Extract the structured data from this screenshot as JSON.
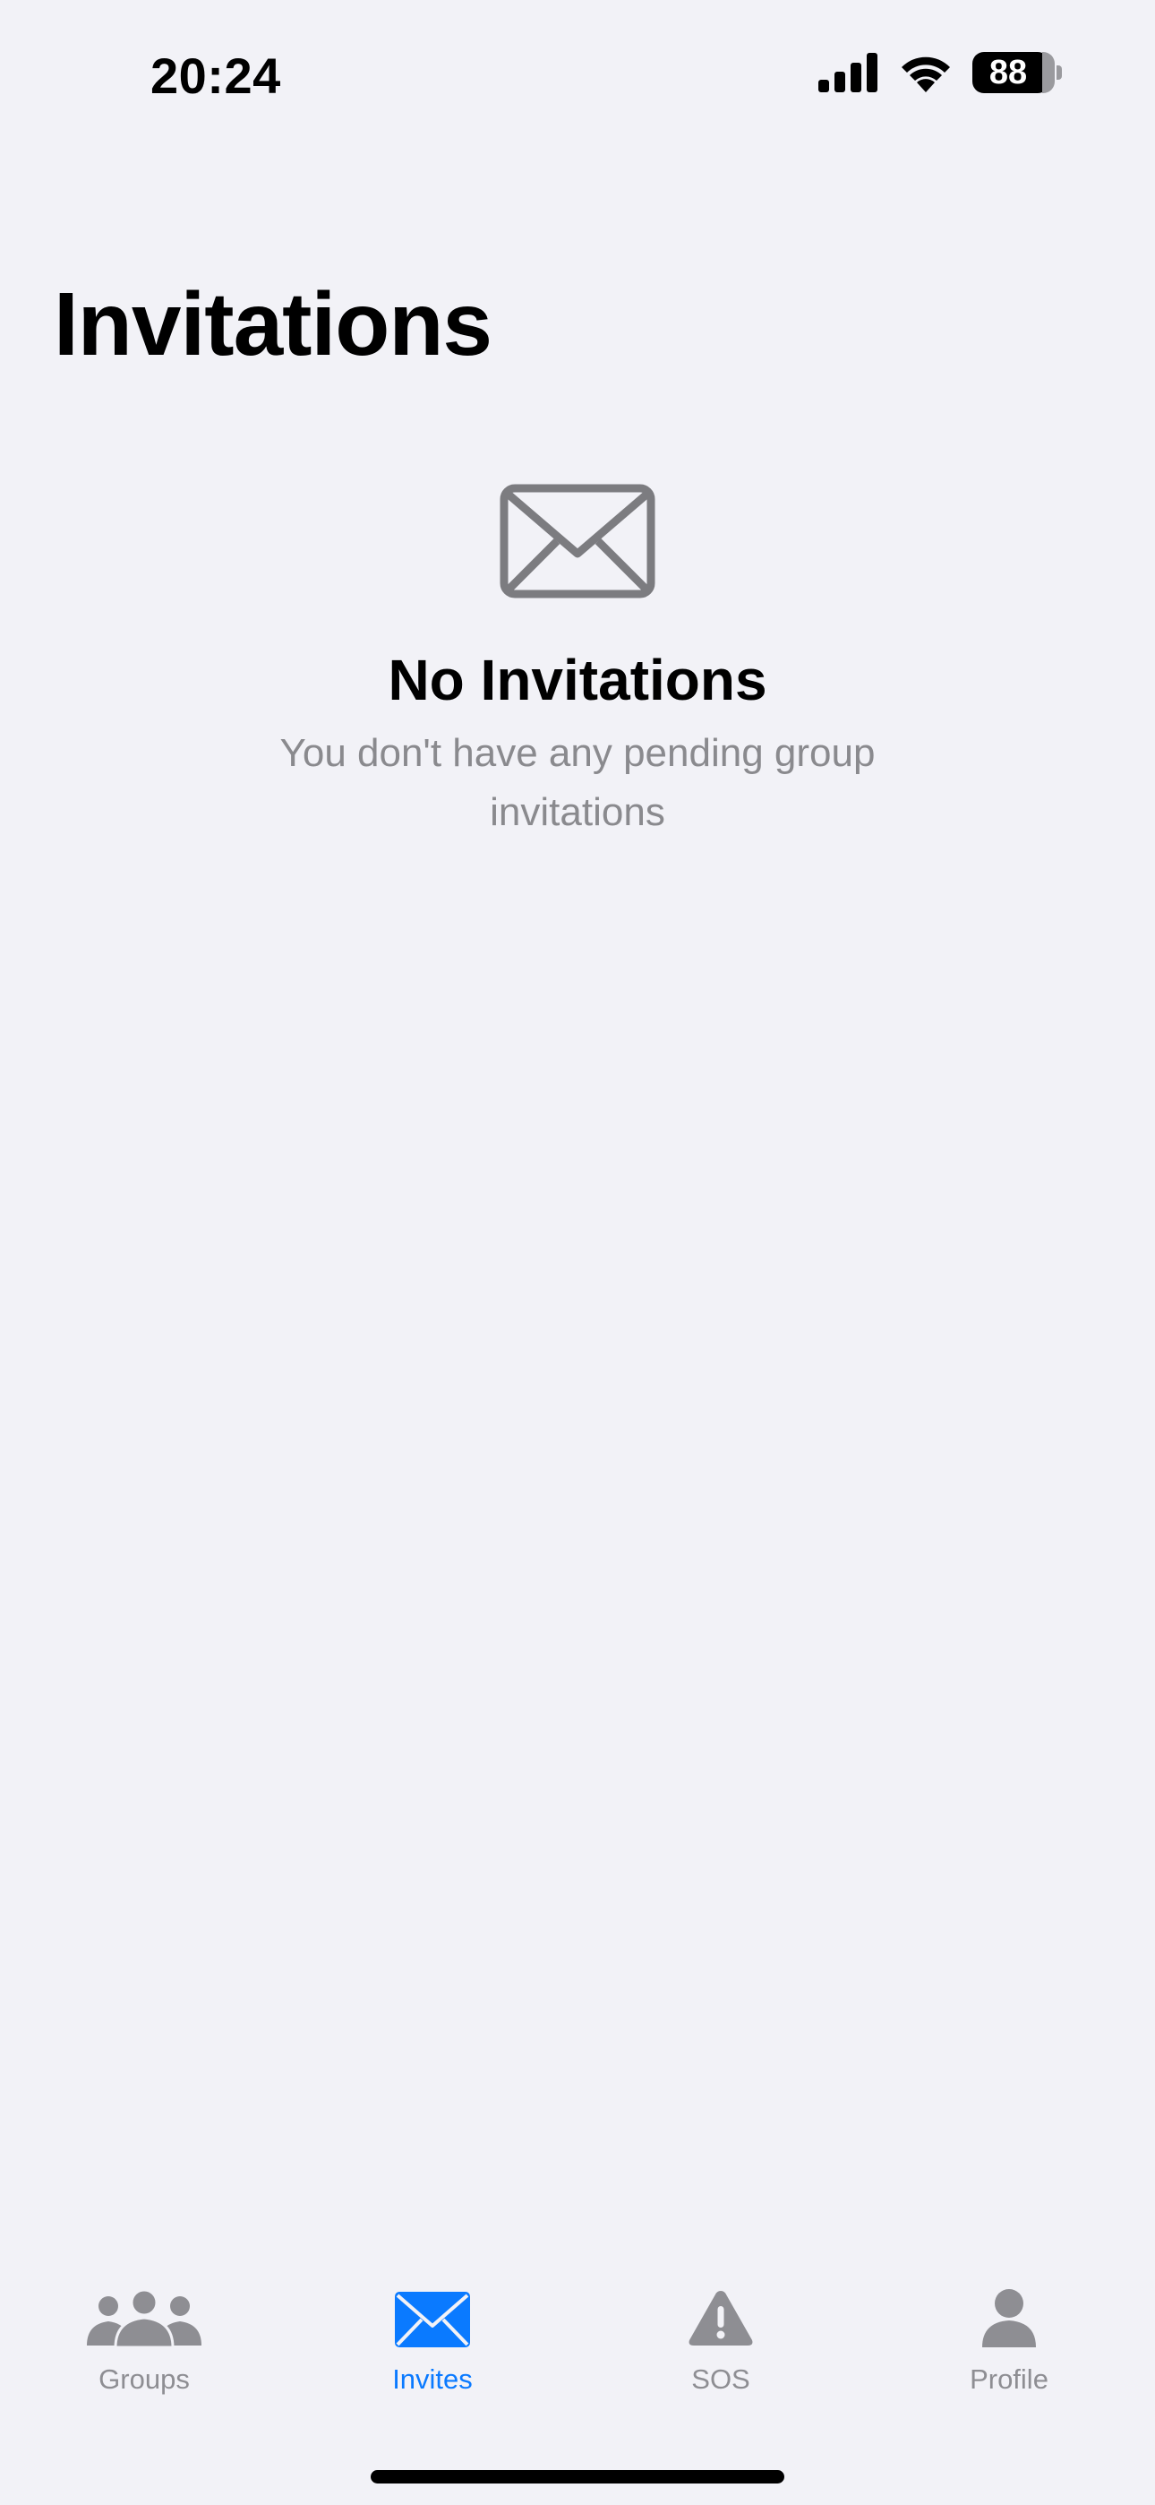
{
  "status_bar": {
    "time": "20:24",
    "battery": "88",
    "icons": [
      "cellular-signal-icon",
      "wifi-icon",
      "battery-icon"
    ]
  },
  "page": {
    "title": "Invitations"
  },
  "empty_state": {
    "icon": "envelope-icon",
    "title": "No Invitations",
    "subtitle": "You don't have any pending group invitations"
  },
  "tab_bar": {
    "active": "Invites",
    "tabs": [
      {
        "label": "Groups",
        "icon": "group-icon"
      },
      {
        "label": "Invites",
        "icon": "envelope-icon"
      },
      {
        "label": "SOS",
        "icon": "warning-triangle-icon"
      },
      {
        "label": "Profile",
        "icon": "person-icon"
      }
    ]
  },
  "colors": {
    "background": "#F2F2F7",
    "accent": "#0A7AFF",
    "inactive": "#8E8E93",
    "secondary_text": "#8A8A8E"
  }
}
